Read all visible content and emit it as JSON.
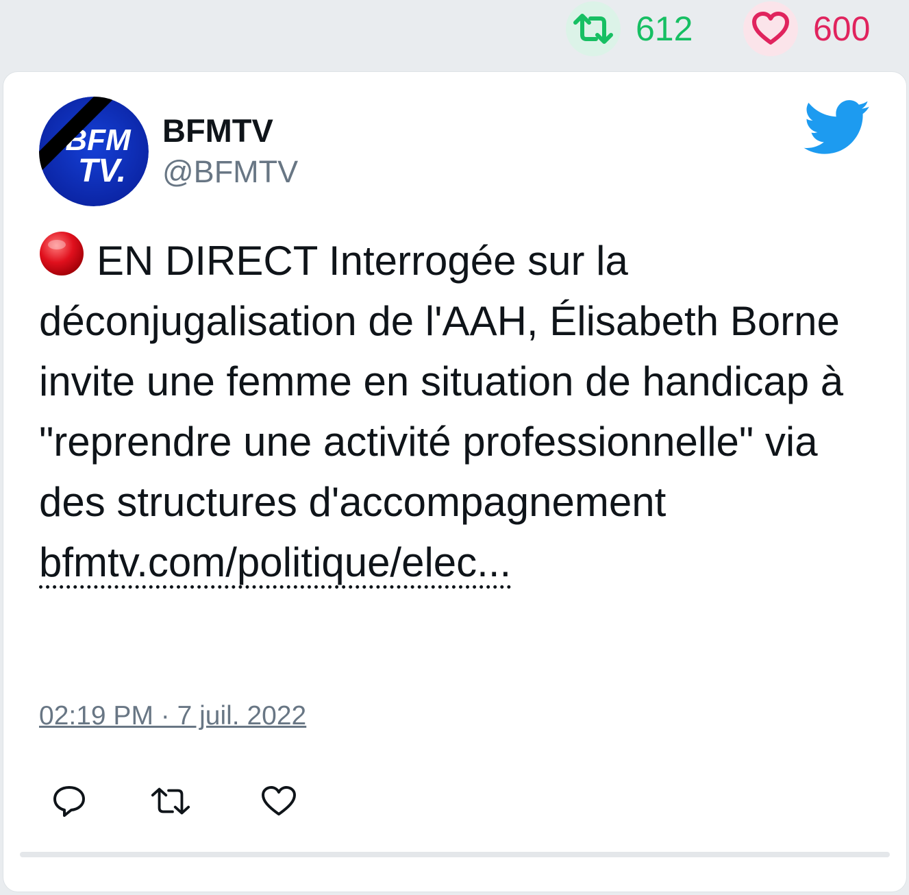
{
  "stats": {
    "retweets": "612",
    "likes": "600",
    "retweet_icon": "retweet-icon",
    "like_icon": "heart-icon"
  },
  "tweet": {
    "author_name": "BFMTV",
    "author_handle": "@BFMTV",
    "avatar_text_top": "BFM",
    "avatar_text_bottom": "TV.",
    "text": "EN DIRECT Interrogée sur la déconjugalisation de l'AAH, Élisabeth Borne invite une femme en situation de handicap à \"reprendre une activité professionnelle\" via des structures d'accompagnement",
    "link": "bfmtv.com/politique/elec...",
    "timestamp": "02:19 PM · 7 juil. 2022"
  },
  "actions": [
    "reply-icon",
    "retweet-icon",
    "heart-icon"
  ],
  "colors": {
    "retweet": "#17bf63",
    "like": "#e0245e",
    "twitter_blue": "#1d9bf0",
    "avatar_blue": "#0a2fb4",
    "live_red": "#e0101d"
  }
}
